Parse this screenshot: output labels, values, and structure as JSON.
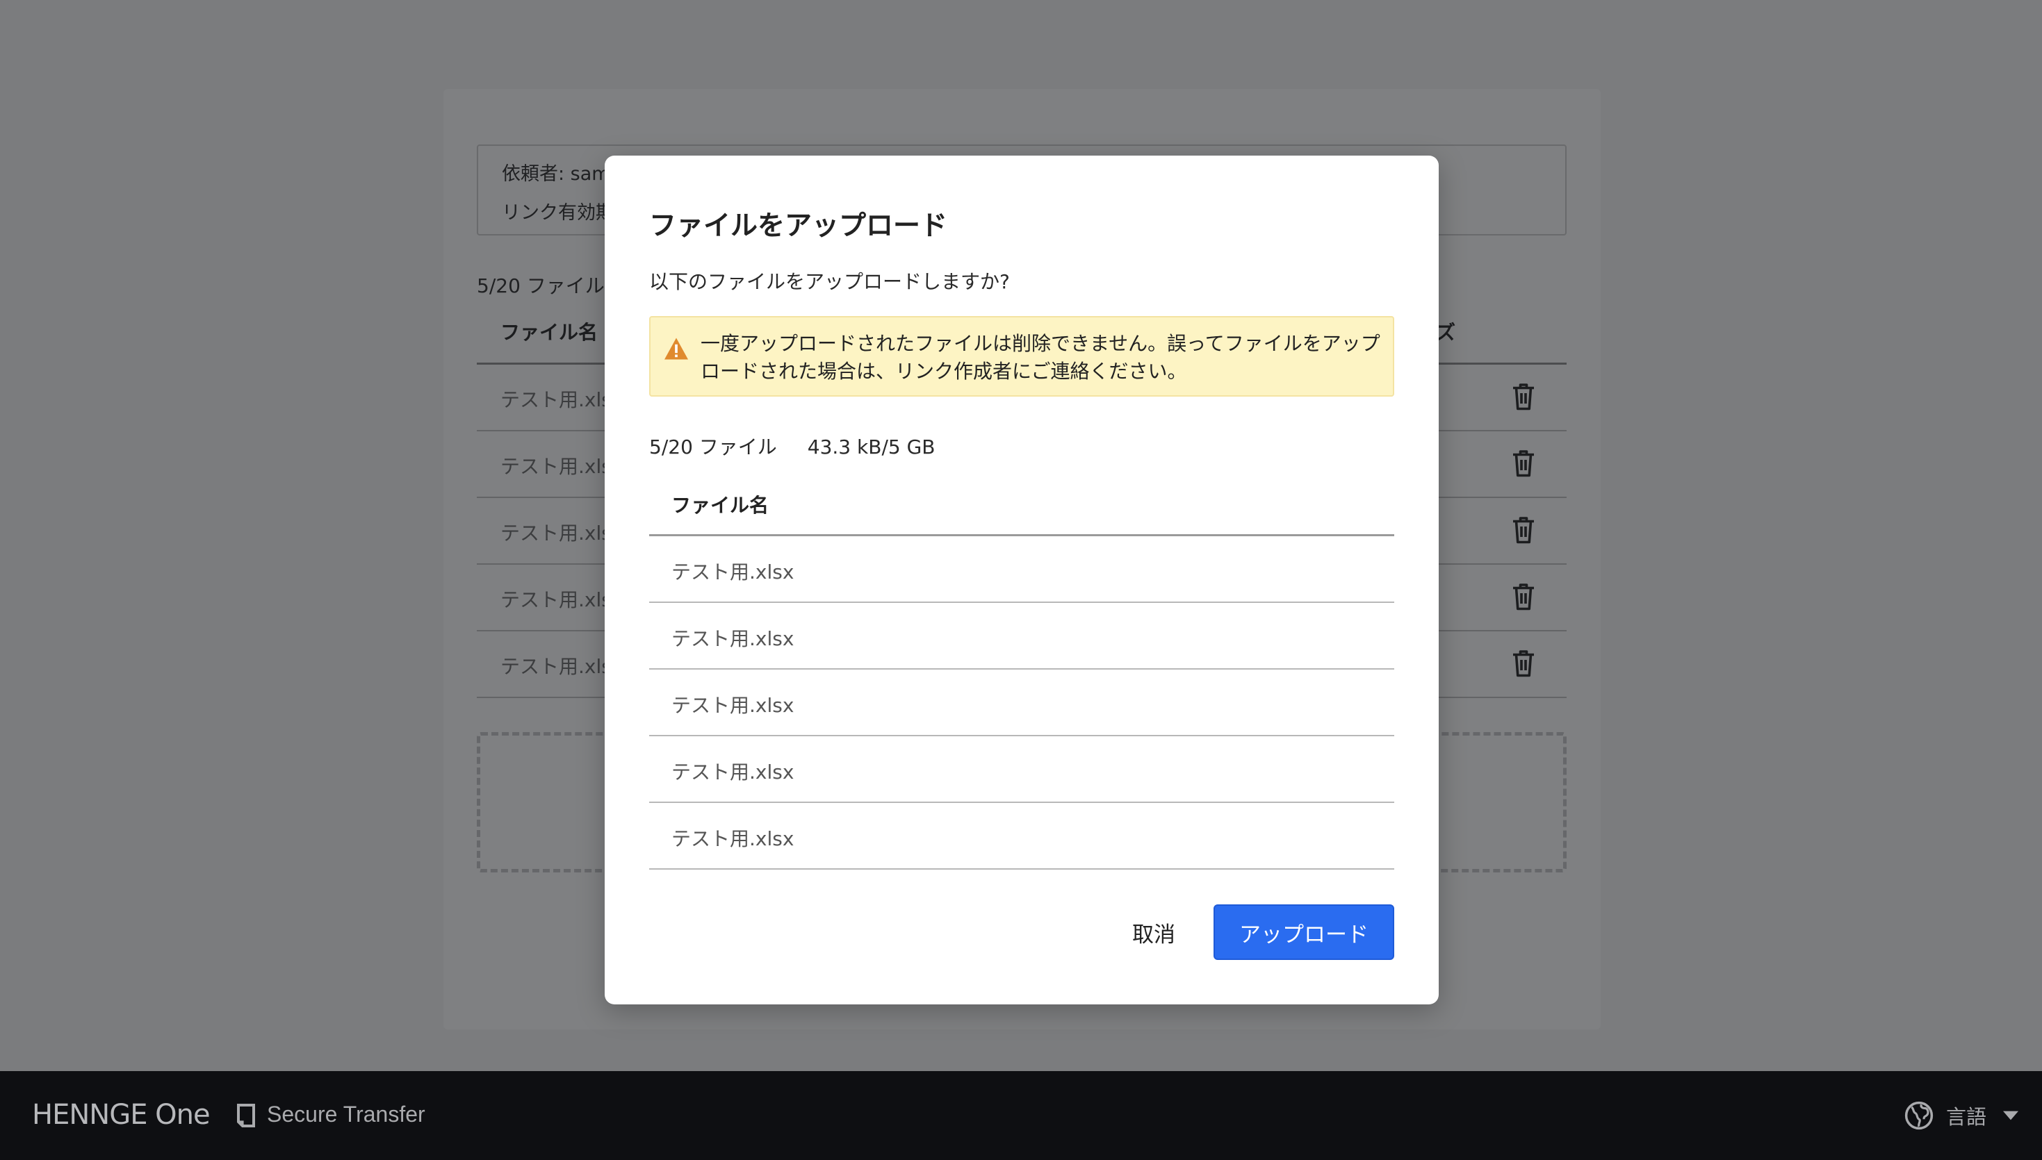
{
  "background": {
    "requester_label": "依頼者: sam",
    "link_expiry_label": "リンク有効期",
    "file_count": "5/20 ファイル",
    "table": {
      "col_name": "ファイル名",
      "col_size": "ズ",
      "rows": [
        "テスト用.xls",
        "テスト用.xls",
        "テスト用.xls",
        "テスト用.xls",
        "テスト用.xls"
      ]
    }
  },
  "modal": {
    "title": "ファイルをアップロード",
    "question": "以下のファイルをアップロードしますか?",
    "warning": "一度アップロードされたファイルは削除できません。誤ってファイルをアップロードされた場合は、リンク作成者にご連絡ください。",
    "file_count": "5/20 ファイル",
    "total_size": "43.3 kB/5 GB",
    "table_header": "ファイル名",
    "files": [
      "テスト用.xlsx",
      "テスト用.xlsx",
      "テスト用.xlsx",
      "テスト用.xlsx",
      "テスト用.xlsx"
    ],
    "cancel_label": "取消",
    "upload_label": "アップロード"
  },
  "footer": {
    "brand": "HENNGE One",
    "product": "Secure Transfer",
    "language_label": "言語"
  },
  "colors": {
    "accent": "#2a6cf0",
    "warning_bg": "#fdf4c4",
    "warning_icon": "#e08a2e",
    "footer_bg": "#0e0f12",
    "overlay": "#7b7c7e"
  },
  "icons": {
    "warning": "warning-triangle-icon",
    "trash": "trash-icon",
    "document": "document-icon",
    "globe": "globe-icon",
    "caret": "caret-down-icon"
  }
}
